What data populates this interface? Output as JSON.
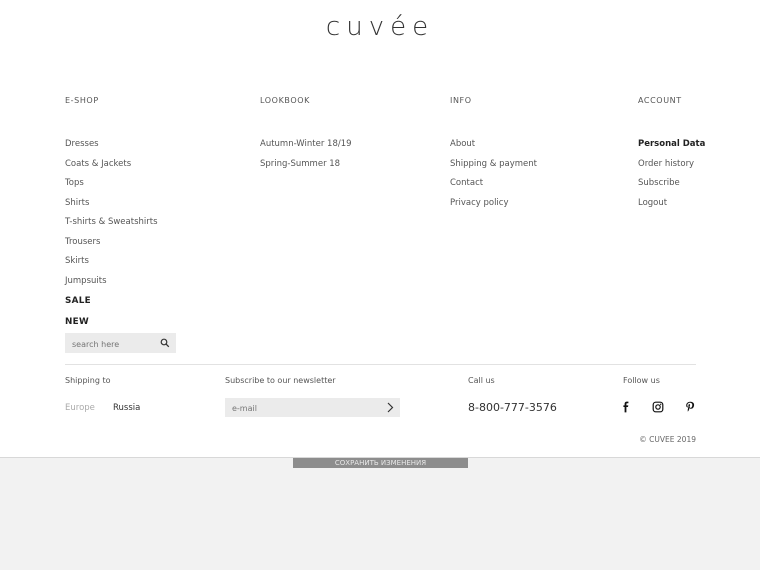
{
  "brand": {
    "logo_text": "cuvée"
  },
  "columns": {
    "eshop": {
      "title": "E-SHOP",
      "items": [
        "Dresses",
        "Coats & Jackets",
        "Tops",
        "Shirts",
        "T-shirts & Sweatshirts",
        "Trousers",
        "Skirts",
        "Jumpsuits"
      ],
      "sale": "SALE",
      "new": "NEW"
    },
    "lookbook": {
      "title": "LOOKBOOK",
      "items": [
        "Autumn-Winter 18/19",
        "Spring-Summer 18"
      ]
    },
    "info": {
      "title": "INFO",
      "items": [
        "About",
        "Shipping & payment",
        "Contact",
        "Privacy policy"
      ]
    },
    "account": {
      "title": "ACCOUNT",
      "items": [
        "Personal Data",
        "Order history",
        "Subscribe",
        "Logout"
      ]
    }
  },
  "search": {
    "placeholder": "search here"
  },
  "shipping": {
    "label": "Shipping to",
    "options": [
      "Europe",
      "Russia"
    ],
    "inactive_color": "#aaaaaa",
    "active_color": "#333333"
  },
  "newsletter": {
    "label": "Subscribe to our newsletter",
    "placeholder": "e-mail"
  },
  "call": {
    "label": "Call us",
    "phone": "8-800-777-3576"
  },
  "follow": {
    "label": "Follow us",
    "icons": [
      "facebook-icon",
      "instagram-icon",
      "pinterest-icon"
    ]
  },
  "copyright": "© CUVEE 2019",
  "save_button": {
    "label": "СОХРАНИТЬ ИЗМЕНЕНИЯ"
  },
  "colors": {
    "background": "#f2f2f2",
    "footer": "#ffffff",
    "field": "#ebebeb",
    "button": "#8d8d8d"
  }
}
